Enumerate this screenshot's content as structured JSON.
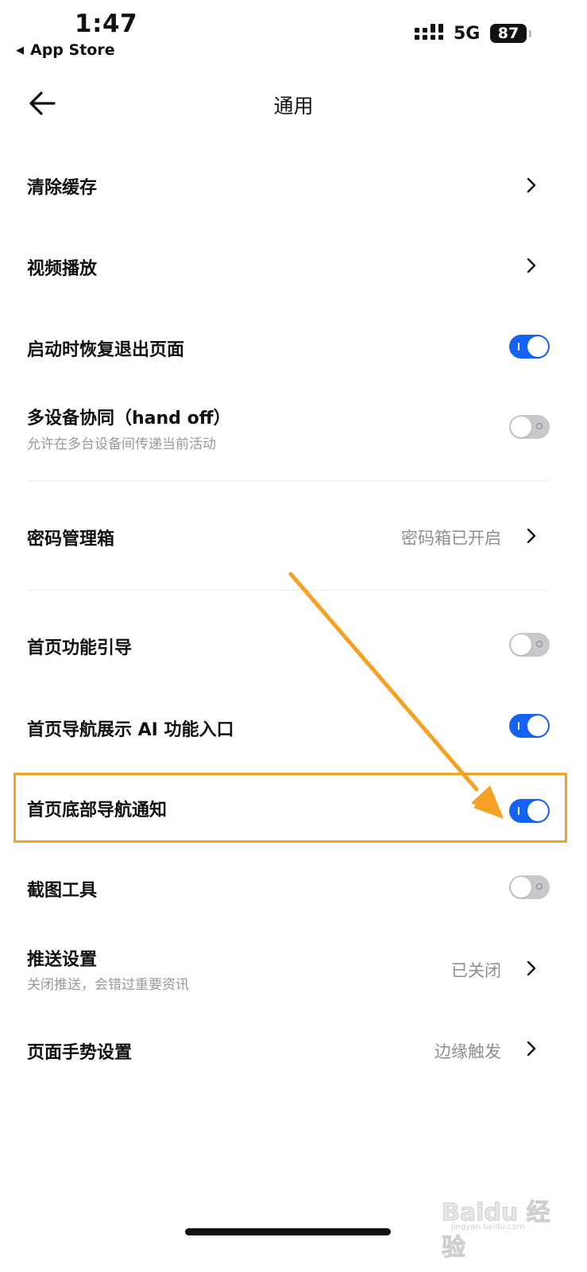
{
  "status": {
    "time": "1:47",
    "back_app": "App Store",
    "network": "5G",
    "battery": "87"
  },
  "nav": {
    "title": "通用"
  },
  "settings": {
    "clear_cache": {
      "label": "清除缓存"
    },
    "video_playback": {
      "label": "视频播放"
    },
    "restore_pages": {
      "label": "启动时恢复退出页面",
      "enabled": true
    },
    "handoff": {
      "label": "多设备协同（hand off）",
      "subtitle": "允许在多台设备间传递当前活动",
      "enabled": false
    },
    "password_manager": {
      "label": "密码管理箱",
      "value": "密码箱已开启"
    },
    "home_guide": {
      "label": "首页功能引导",
      "enabled": false
    },
    "home_ai_entry": {
      "label": "首页导航展示 AI 功能入口",
      "enabled": true
    },
    "home_bottom_notify": {
      "label": "首页底部导航通知",
      "enabled": true
    },
    "screenshot_tool": {
      "label": "截图工具",
      "enabled": false
    },
    "push_settings": {
      "label": "推送设置",
      "subtitle": "关闭推送，会错过重要资讯",
      "value": "已关闭"
    },
    "gesture_settings": {
      "label": "页面手势设置",
      "value": "边缘触发"
    }
  },
  "watermark": {
    "logo": "Baidu 经验",
    "sub": "jingyan.baidu.com"
  },
  "colors": {
    "toggle_on": "#1463f5",
    "toggle_off": "#c8c8cc",
    "highlight": "#f4a124"
  }
}
